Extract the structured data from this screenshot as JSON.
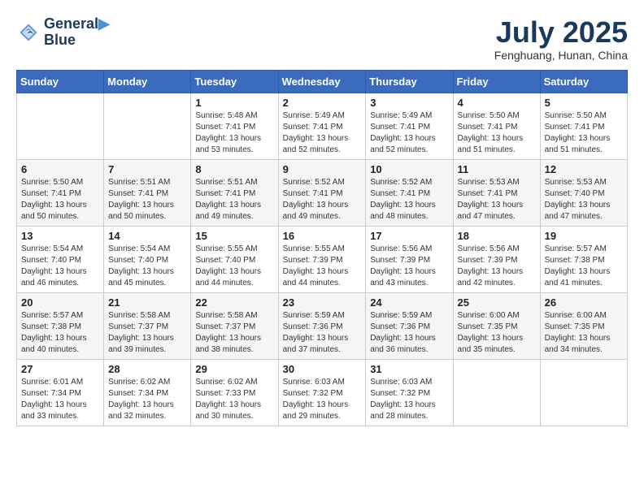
{
  "header": {
    "logo_line1": "General",
    "logo_line2": "Blue",
    "month_title": "July 2025",
    "location": "Fenghuang, Hunan, China"
  },
  "days_of_week": [
    "Sunday",
    "Monday",
    "Tuesday",
    "Wednesday",
    "Thursday",
    "Friday",
    "Saturday"
  ],
  "weeks": [
    [
      {
        "day": "",
        "info": ""
      },
      {
        "day": "",
        "info": ""
      },
      {
        "day": "1",
        "info": "Sunrise: 5:48 AM\nSunset: 7:41 PM\nDaylight: 13 hours and 53 minutes."
      },
      {
        "day": "2",
        "info": "Sunrise: 5:49 AM\nSunset: 7:41 PM\nDaylight: 13 hours and 52 minutes."
      },
      {
        "day": "3",
        "info": "Sunrise: 5:49 AM\nSunset: 7:41 PM\nDaylight: 13 hours and 52 minutes."
      },
      {
        "day": "4",
        "info": "Sunrise: 5:50 AM\nSunset: 7:41 PM\nDaylight: 13 hours and 51 minutes."
      },
      {
        "day": "5",
        "info": "Sunrise: 5:50 AM\nSunset: 7:41 PM\nDaylight: 13 hours and 51 minutes."
      }
    ],
    [
      {
        "day": "6",
        "info": "Sunrise: 5:50 AM\nSunset: 7:41 PM\nDaylight: 13 hours and 50 minutes."
      },
      {
        "day": "7",
        "info": "Sunrise: 5:51 AM\nSunset: 7:41 PM\nDaylight: 13 hours and 50 minutes."
      },
      {
        "day": "8",
        "info": "Sunrise: 5:51 AM\nSunset: 7:41 PM\nDaylight: 13 hours and 49 minutes."
      },
      {
        "day": "9",
        "info": "Sunrise: 5:52 AM\nSunset: 7:41 PM\nDaylight: 13 hours and 49 minutes."
      },
      {
        "day": "10",
        "info": "Sunrise: 5:52 AM\nSunset: 7:41 PM\nDaylight: 13 hours and 48 minutes."
      },
      {
        "day": "11",
        "info": "Sunrise: 5:53 AM\nSunset: 7:41 PM\nDaylight: 13 hours and 47 minutes."
      },
      {
        "day": "12",
        "info": "Sunrise: 5:53 AM\nSunset: 7:40 PM\nDaylight: 13 hours and 47 minutes."
      }
    ],
    [
      {
        "day": "13",
        "info": "Sunrise: 5:54 AM\nSunset: 7:40 PM\nDaylight: 13 hours and 46 minutes."
      },
      {
        "day": "14",
        "info": "Sunrise: 5:54 AM\nSunset: 7:40 PM\nDaylight: 13 hours and 45 minutes."
      },
      {
        "day": "15",
        "info": "Sunrise: 5:55 AM\nSunset: 7:40 PM\nDaylight: 13 hours and 44 minutes."
      },
      {
        "day": "16",
        "info": "Sunrise: 5:55 AM\nSunset: 7:39 PM\nDaylight: 13 hours and 44 minutes."
      },
      {
        "day": "17",
        "info": "Sunrise: 5:56 AM\nSunset: 7:39 PM\nDaylight: 13 hours and 43 minutes."
      },
      {
        "day": "18",
        "info": "Sunrise: 5:56 AM\nSunset: 7:39 PM\nDaylight: 13 hours and 42 minutes."
      },
      {
        "day": "19",
        "info": "Sunrise: 5:57 AM\nSunset: 7:38 PM\nDaylight: 13 hours and 41 minutes."
      }
    ],
    [
      {
        "day": "20",
        "info": "Sunrise: 5:57 AM\nSunset: 7:38 PM\nDaylight: 13 hours and 40 minutes."
      },
      {
        "day": "21",
        "info": "Sunrise: 5:58 AM\nSunset: 7:37 PM\nDaylight: 13 hours and 39 minutes."
      },
      {
        "day": "22",
        "info": "Sunrise: 5:58 AM\nSunset: 7:37 PM\nDaylight: 13 hours and 38 minutes."
      },
      {
        "day": "23",
        "info": "Sunrise: 5:59 AM\nSunset: 7:36 PM\nDaylight: 13 hours and 37 minutes."
      },
      {
        "day": "24",
        "info": "Sunrise: 5:59 AM\nSunset: 7:36 PM\nDaylight: 13 hours and 36 minutes."
      },
      {
        "day": "25",
        "info": "Sunrise: 6:00 AM\nSunset: 7:35 PM\nDaylight: 13 hours and 35 minutes."
      },
      {
        "day": "26",
        "info": "Sunrise: 6:00 AM\nSunset: 7:35 PM\nDaylight: 13 hours and 34 minutes."
      }
    ],
    [
      {
        "day": "27",
        "info": "Sunrise: 6:01 AM\nSunset: 7:34 PM\nDaylight: 13 hours and 33 minutes."
      },
      {
        "day": "28",
        "info": "Sunrise: 6:02 AM\nSunset: 7:34 PM\nDaylight: 13 hours and 32 minutes."
      },
      {
        "day": "29",
        "info": "Sunrise: 6:02 AM\nSunset: 7:33 PM\nDaylight: 13 hours and 30 minutes."
      },
      {
        "day": "30",
        "info": "Sunrise: 6:03 AM\nSunset: 7:32 PM\nDaylight: 13 hours and 29 minutes."
      },
      {
        "day": "31",
        "info": "Sunrise: 6:03 AM\nSunset: 7:32 PM\nDaylight: 13 hours and 28 minutes."
      },
      {
        "day": "",
        "info": ""
      },
      {
        "day": "",
        "info": ""
      }
    ]
  ]
}
